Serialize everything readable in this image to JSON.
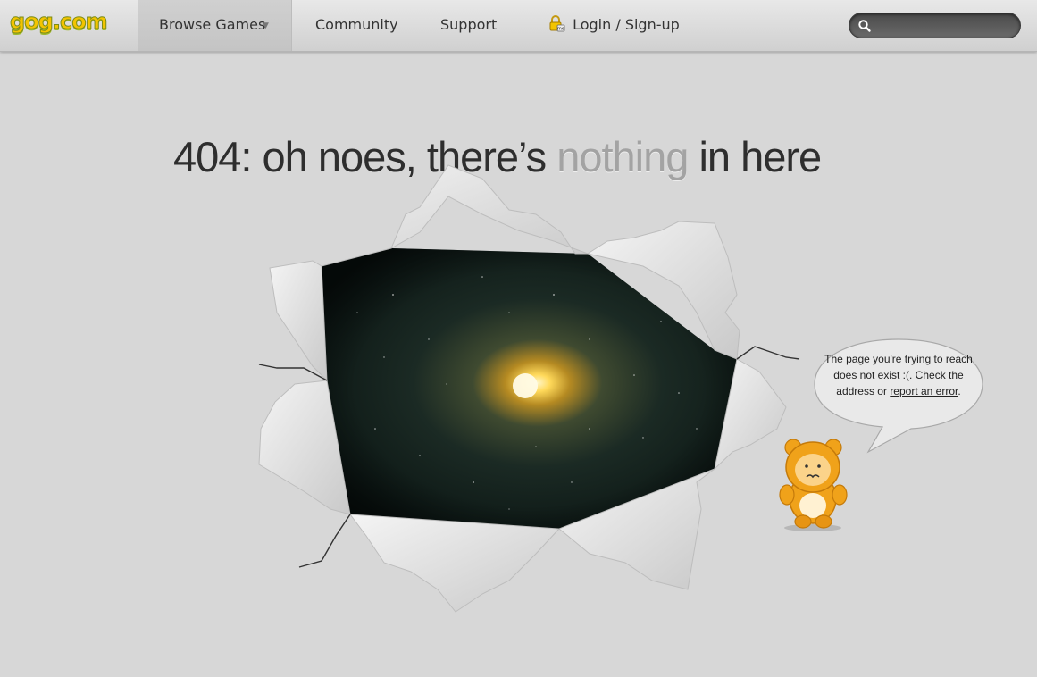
{
  "header": {
    "logo_text": "gog.com",
    "nav": {
      "browse_label": "Browse Games",
      "community_label": "Community",
      "support_label": "Support",
      "login_label": "Login / Sign-up"
    },
    "search": {
      "placeholder": "",
      "value": ""
    }
  },
  "main": {
    "headline": {
      "prefix": "404: oh noes, there’s ",
      "highlight": "nothing",
      "suffix": " in here"
    },
    "bubble": {
      "text": "The page you're trying to reach does not exist :(. Check the address or ",
      "link_text": "report an error",
      "end": "."
    }
  },
  "colors": {
    "background": "#d7d7d7",
    "logo_yellow": "#f3c400",
    "mascot_orange": "#f0a21a"
  },
  "icons": {
    "caret": "caret-down-icon",
    "login": "lock-icon",
    "search": "search-icon"
  }
}
